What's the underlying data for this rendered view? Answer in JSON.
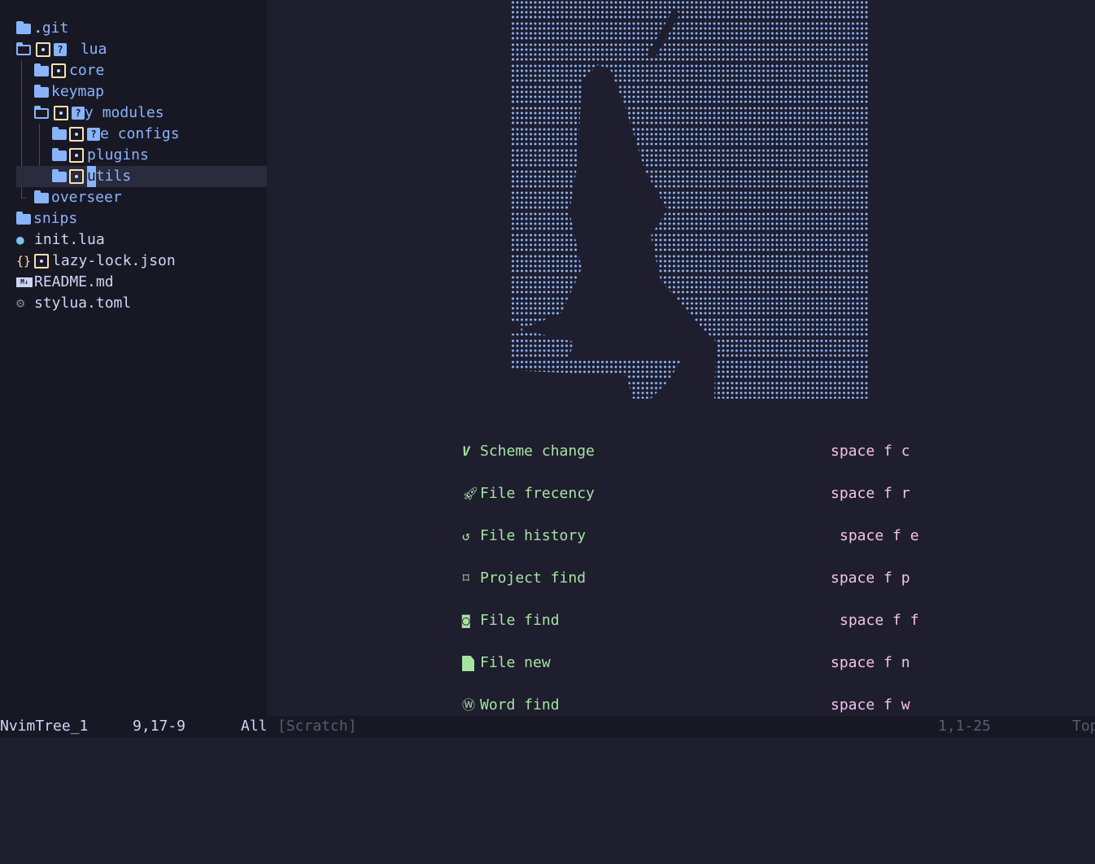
{
  "tree": {
    "parent": "/..",
    "items": [
      {
        "name": ".git",
        "type": "dir"
      },
      {
        "name": "lua",
        "type": "dir-open",
        "git": [
          "dirty",
          "untracked"
        ],
        "prefix": " "
      },
      {
        "name": "core",
        "type": "dir",
        "git": [
          "dirty"
        ]
      },
      {
        "name": "keymap",
        "type": "dir"
      },
      {
        "name": "modules",
        "type": "dir-open",
        "git": [
          "dirty",
          "untracked"
        ],
        "prefix": "y "
      },
      {
        "name": "configs",
        "type": "dir",
        "git": [
          "dirty",
          "untracked"
        ],
        "prefix": "e "
      },
      {
        "name": "plugins",
        "type": "dir",
        "git": [
          "dirty"
        ]
      },
      {
        "name": "tils",
        "cursor_char": "u",
        "type": "dir",
        "git": [
          "dirty"
        ],
        "selected": true
      },
      {
        "name": "overseer",
        "type": "dir"
      },
      {
        "name": "snips",
        "type": "dir"
      },
      {
        "name": "init.lua",
        "type": "file",
        "icon": "lua-icon"
      },
      {
        "name": "lazy-lock.json",
        "type": "file",
        "icon": "json-icon",
        "git": [
          "dirty"
        ]
      },
      {
        "name": "README.md",
        "type": "file",
        "icon": "markdown-icon"
      },
      {
        "name": "stylua.toml",
        "type": "file",
        "icon": "gear-icon"
      }
    ],
    "git_untracked_glyph": "?"
  },
  "dashboard": {
    "items": [
      {
        "label": "Scheme change",
        "key": "space f c",
        "icon": "vim-icon"
      },
      {
        "label": "File frecency",
        "key": "space f r",
        "icon": "rocket-icon"
      },
      {
        "label": "File history",
        "key": "space f e",
        "icon": "history-icon"
      },
      {
        "label": "Project find",
        "key": "space f p",
        "icon": "bookmark-icon"
      },
      {
        "label": "File find",
        "key": "space f f",
        "icon": "file-search-icon"
      },
      {
        "label": "File new",
        "key": "space f n",
        "icon": "file-icon"
      },
      {
        "label": "Word find",
        "key": "space f w",
        "icon": "wordpress-icon"
      }
    ]
  },
  "statusline": {
    "left_buffer": "NvimTree_1",
    "left_position": "9,17-9",
    "left_scroll": "All",
    "right_buffer": "[Scratch]",
    "right_position": "1,1-25",
    "right_scroll": "Top"
  },
  "colors": {
    "accent_blue": "#89b4fa",
    "git_dirty": "#f9e2af",
    "dashboard_label": "#a6e3a1",
    "dashboard_key": "#f5c2e7",
    "sidebar_bg": "#181825",
    "editor_bg": "#1e1e2e"
  }
}
